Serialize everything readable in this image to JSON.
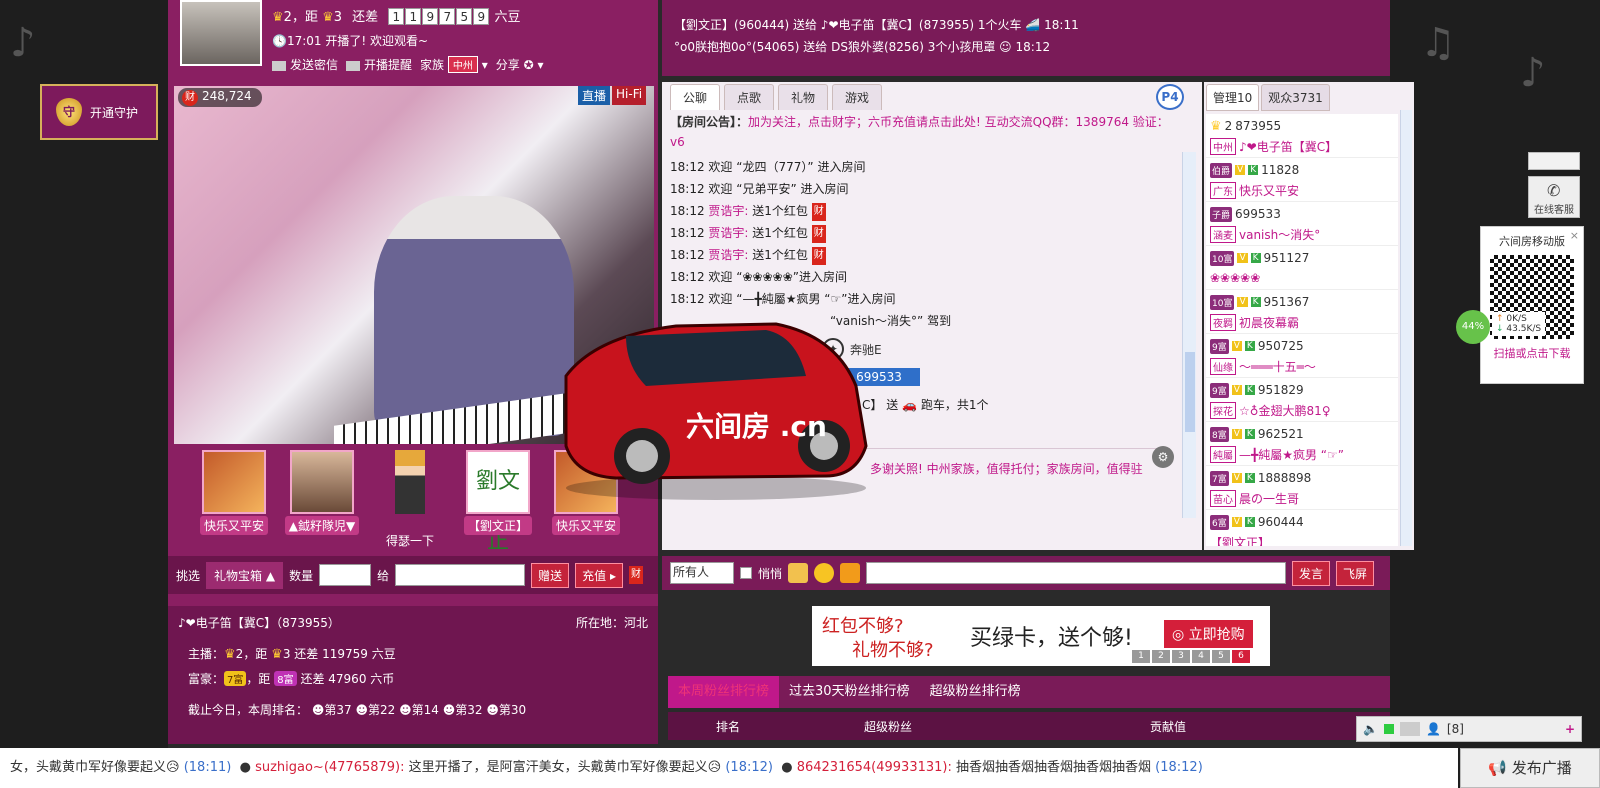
{
  "guard": {
    "label": "开通守护"
  },
  "host": {
    "level_a": "2",
    "sep": "，距",
    "level_b": "3",
    "gap_label": "还差",
    "digits": [
      "1",
      "1",
      "9",
      "7",
      "5",
      "9"
    ],
    "unit": "六豆",
    "time": "17:01",
    "started": "开播了! 欢迎观看~",
    "actions": [
      "发送密信",
      "开播提醒",
      "家族",
      "分享"
    ],
    "family_tag": "中州"
  },
  "video": {
    "wealth": "248,724",
    "tab_live": "直播",
    "tab_hifi": "Hi-Fi",
    "cai": "财"
  },
  "fans": [
    {
      "label": "快乐又平安"
    },
    {
      "label": "▲鉞籽隊児▼"
    },
    {
      "label": "得瑟一下"
    },
    {
      "label": "【劉文正】"
    },
    {
      "label": "快乐又平安"
    }
  ],
  "giftbar": {
    "pick": "挑选",
    "box": "礼物宝箱",
    "qty": "数量",
    "to": "给",
    "send": "赠送",
    "recharge": "充值"
  },
  "anchor": {
    "name": "♪❤电子笛【冀C】（873955）",
    "loc": "所在地：河北",
    "r1_label": "主播：",
    "r1_lv": "2",
    "r1_sep": "，距",
    "r1_lv2": "3",
    "r1_gap": "还差",
    "r1_val": "119759 六豆",
    "r2_label": "富豪：",
    "r2_lv": "7富",
    "r2_sep": "，距",
    "r2_lv2": "8富",
    "r2_gap": "还差",
    "r2_val": "47960 六币",
    "r3_label": "截止今日，本周排名：",
    "ranks": [
      "第37",
      "第22",
      "第14",
      "第32",
      "第30"
    ]
  },
  "topmsgs": [
    {
      "text": "【劉文正】(960444) 送给 ♪❤电子笛【冀C】(873955) 1个火车",
      "time": "18:11"
    },
    {
      "text": "°o0朕抱抱0o°(54065) 送给 DS狼外婆(8256) 3个小孩甩罩",
      "time": "18:12"
    }
  ],
  "chat": {
    "tabs": [
      "公聊",
      "点歌",
      "礼物",
      "游戏"
    ],
    "p_badge": "P4",
    "notice_head": "【房间公告】：",
    "notice_body": "加为关注，点击财字；六币充值请点击此处! 互动交流QQ群：1389764 验证：v6",
    "lines": [
      {
        "t": "18:12",
        "pre": "欢迎",
        "name": "“龙四（777）”",
        "post": "进入房间",
        "cai": ""
      },
      {
        "t": "18:12",
        "pre": "欢迎",
        "name": "“兄弟平安”",
        "post": "进入房间",
        "cai": ""
      },
      {
        "t": "18:12",
        "pre": "",
        "name": "贾诰宇:",
        "post": "送1个红包",
        "cai": "财"
      },
      {
        "t": "18:12",
        "pre": "",
        "name": "贾诰宇:",
        "post": "送1个红包",
        "cai": "财"
      },
      {
        "t": "18:12",
        "pre": "",
        "name": "贾诰宇:",
        "post": "送1个红包",
        "cai": "财"
      },
      {
        "t": "18:12",
        "pre": "欢迎",
        "name": "“❀❀❀❀❀”",
        "post": "进入房间",
        "cai": ""
      },
      {
        "t": "18:12",
        "pre": "欢迎",
        "name": "“—╋純屬★疯男 “☞”",
        "post": "进入房间",
        "cai": ""
      },
      {
        "t": "",
        "pre": "",
        "name": "“vanish〜消失°”",
        "post": "驾到",
        "cai": ""
      }
    ],
    "car_brand": "奔驰E",
    "car_id": "699533",
    "car_send": "C】 送",
    "car_gift": "跑车，共1个",
    "bottom": "多谢关照! 中州家族，值得托付；家族房间，值得驻",
    "car_text": "六间房 .cn"
  },
  "users": {
    "tabs": [
      "管理10",
      "观众3731"
    ],
    "list": [
      {
        "lv": "2",
        "id": "873955",
        "place": "中州",
        "name": "♪❤电子笛【冀C】"
      },
      {
        "lv": "伯爵",
        "id": "11828",
        "place": "广东",
        "name": "快乐又平安"
      },
      {
        "lv": "子爵",
        "id": "699533",
        "place": "涵麦",
        "name": "vanish〜消失°"
      },
      {
        "lv": "10富",
        "id": "951127",
        "place": "",
        "name": "❀❀❀❀❀"
      },
      {
        "lv": "10富",
        "id": "951367",
        "place": "夜羁",
        "name": "初晨夜幕霸"
      },
      {
        "lv": "9富",
        "id": "950725",
        "place": "仙缘",
        "name": "〜═══十五═〜"
      },
      {
        "lv": "9富",
        "id": "951829",
        "place": "探花",
        "name": "☆♁金翅大鹏81♀"
      },
      {
        "lv": "8富",
        "id": "962521",
        "place": "純屬",
        "name": "—╋純屬★疯男 “☞”"
      },
      {
        "lv": "7富",
        "id": "1888898",
        "place": "苗心",
        "name": "晨の一生哥"
      },
      {
        "lv": "6富",
        "id": "960444",
        "place": "",
        "name": "【劉文正】"
      }
    ]
  },
  "inputbar": {
    "target": "所有人",
    "whisper": "悄悄",
    "send": "发言",
    "fly": "飞屏"
  },
  "banner": {
    "t1": "红包不够?",
    "t2": "礼物不够?",
    "t3": "买绿卡，送个够!",
    "btn": "立即抢购",
    "pages": [
      "1",
      "2",
      "3",
      "4",
      "5",
      "6"
    ]
  },
  "rank": {
    "tabs": [
      "本周粉丝排行榜",
      "过去30天粉丝排行榜",
      "超级粉丝排行榜"
    ],
    "cols": [
      "排名",
      "超级粉丝",
      "贡献值"
    ]
  },
  "side": {
    "svc": "在线客服",
    "mobile": "六间房移动版",
    "scan": "扫描或点击下载",
    "net": "44%",
    "up": "0K/S",
    "down": "43.5K/S"
  },
  "vol": {
    "count": "[8]"
  },
  "ticker": {
    "seg1": "女，头戴黄巾军好像要起义😥",
    "t1": "(18:11)",
    "u2": "suzhigao~(47765879):",
    "seg2": "这里开播了，是阿富汗美女，头戴黄巾军好像要起义😥",
    "t2": "(18:12)",
    "u3": "864231654(49933131):",
    "seg3": "抽香烟抽香烟抽香烟抽香烟抽香烟",
    "t3": "(18:12)"
  },
  "publish": "发布广播",
  "colors": {
    "brand": "#8a1f62",
    "accent": "#c0188a",
    "red": "#d41f3a"
  }
}
